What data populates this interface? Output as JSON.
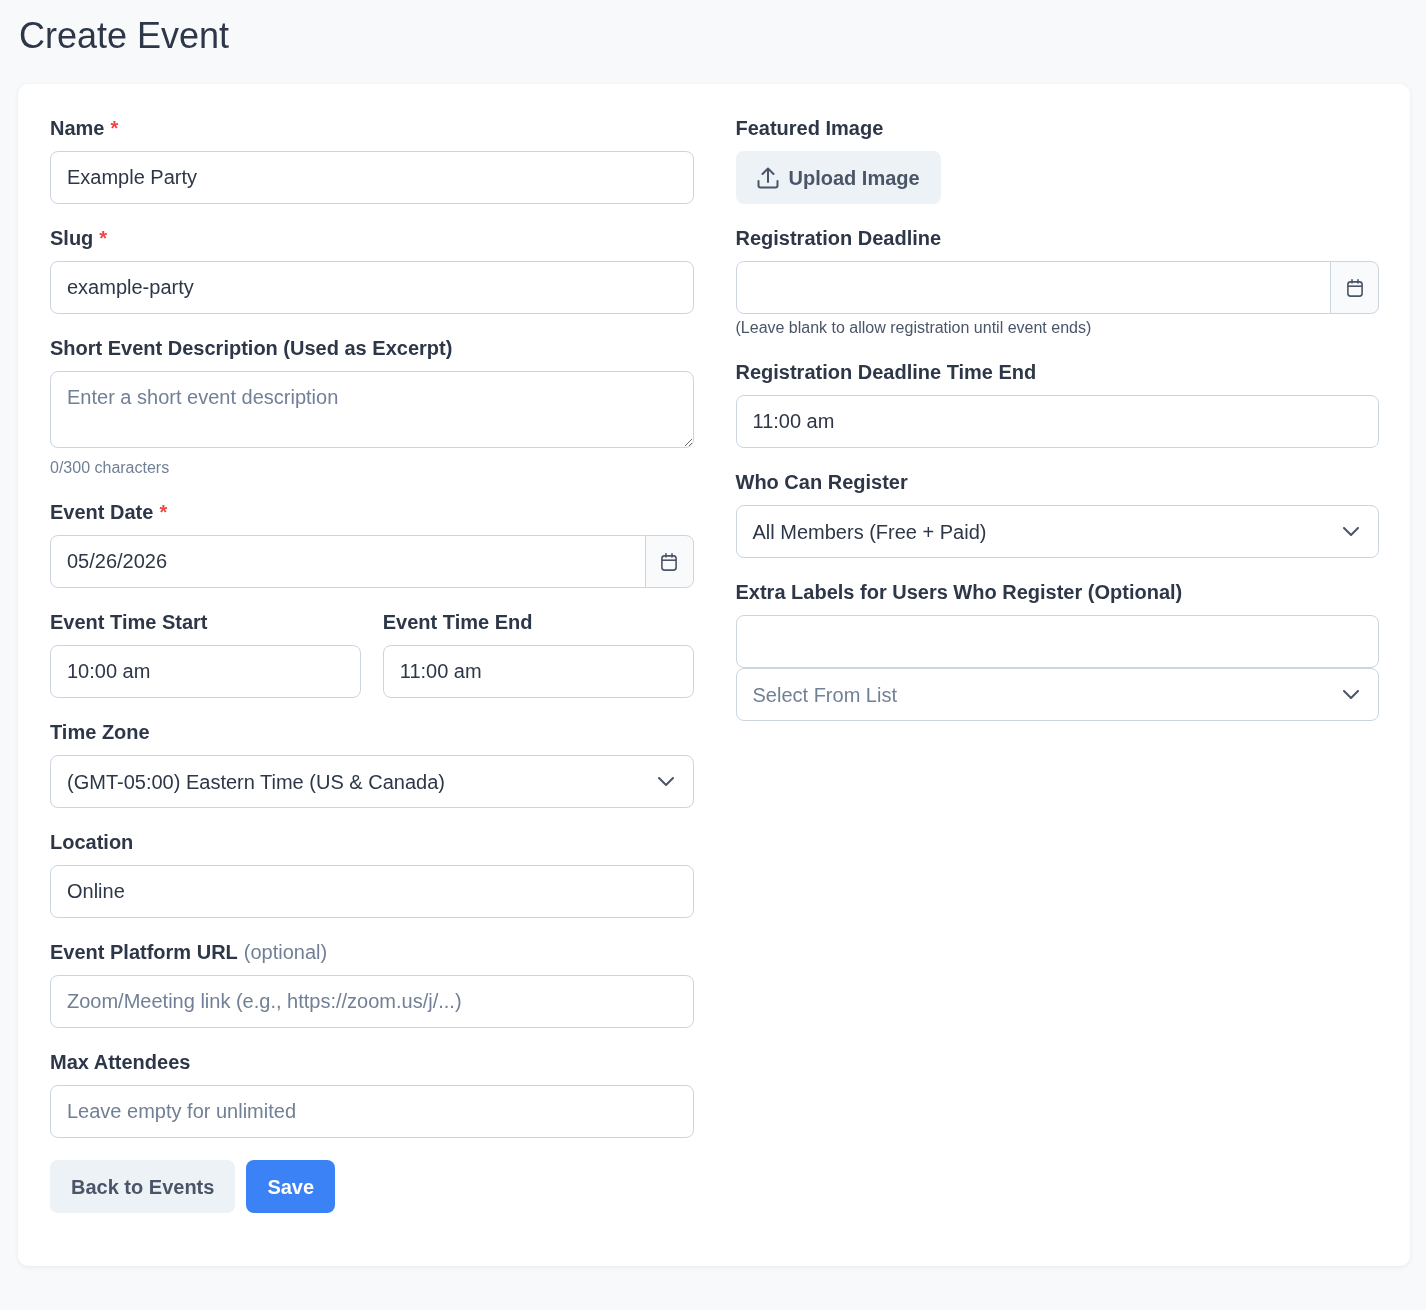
{
  "page": {
    "title": "Create Event"
  },
  "required_mark": "*",
  "left_fields": [
    {
      "kind": "text",
      "label": "Name",
      "required": true,
      "value": "Example Party"
    },
    {
      "kind": "text",
      "label": "Slug",
      "required": true,
      "value": "example-party"
    },
    {
      "kind": "textarea",
      "label": "Short Event Description (Used as Excerpt)",
      "required": false,
      "placeholder": "Enter a short event description",
      "counter": "0/300 characters"
    },
    {
      "kind": "date",
      "label": "Event Date",
      "required": true,
      "value": "05/26/2026"
    },
    {
      "kind": "pair",
      "fields": [
        {
          "kind": "time",
          "label": "Event Time Start",
          "required": false,
          "value": "10:00 am"
        },
        {
          "kind": "time",
          "label": "Event Time End",
          "required": false,
          "value": "11:00 am"
        }
      ]
    },
    {
      "kind": "select",
      "label": "Time Zone",
      "required": false,
      "value": "(GMT-05:00) Eastern Time (US & Canada)"
    },
    {
      "kind": "text",
      "label": "Location",
      "required": false,
      "value": "Online"
    },
    {
      "kind": "text",
      "label": "Event Platform URL",
      "required": false,
      "note": "(optional)",
      "placeholder": "Zoom/Meeting link (e.g., https://zoom.us/j/...)"
    },
    {
      "kind": "text",
      "label": "Max Attendees",
      "required": false,
      "placeholder": "Leave empty for unlimited"
    }
  ],
  "right_fields": [
    {
      "kind": "upload",
      "label": "Featured Image",
      "required": false,
      "button": "Upload Image"
    },
    {
      "kind": "date",
      "label": "Registration Deadline",
      "required": false,
      "help": "(Leave blank to allow registration until event ends)"
    },
    {
      "kind": "time",
      "label": "Registration Deadline Time End",
      "required": false,
      "value": "11:00 am"
    },
    {
      "kind": "select",
      "label": "Who Can Register",
      "required": false,
      "value": "All Members (Free + Paid)"
    },
    {
      "kind": "tags",
      "label": "Extra Labels for Users Who Register (Optional)",
      "required": false,
      "list_placeholder": "Select From List"
    }
  ],
  "actions": [
    {
      "kind": "secondary",
      "label": "Back to Events"
    },
    {
      "kind": "primary",
      "label": "Save"
    }
  ]
}
